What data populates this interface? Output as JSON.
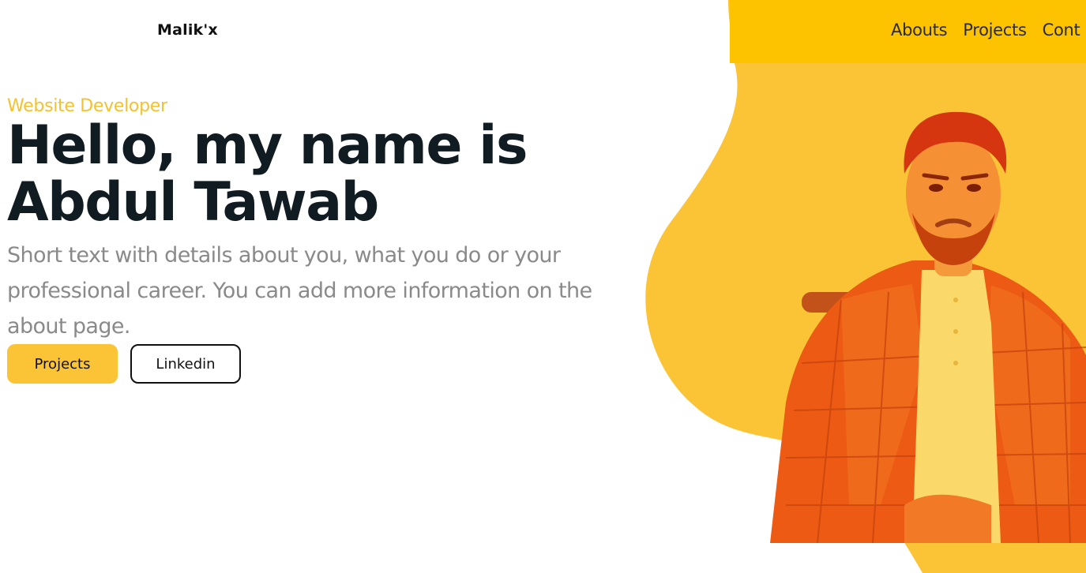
{
  "header": {
    "brand": "Malik'x",
    "nav": [
      "Abouts",
      "Projects",
      "Cont"
    ]
  },
  "hero": {
    "eyebrow": "Website Developer",
    "headline": "Hello, my name is Abdul Tawab",
    "intro": "Short text with details about you, what you do or your professional career. You can add more information on the about page.",
    "buttons": {
      "primary": "Projects",
      "secondary": "Linkedin"
    }
  },
  "colors": {
    "accent": "#fbc437",
    "accent_dark": "#fdc300",
    "heading": "#111b22",
    "muted": "#8a8a8a"
  },
  "icons": {
    "portrait": "person-portrait"
  }
}
